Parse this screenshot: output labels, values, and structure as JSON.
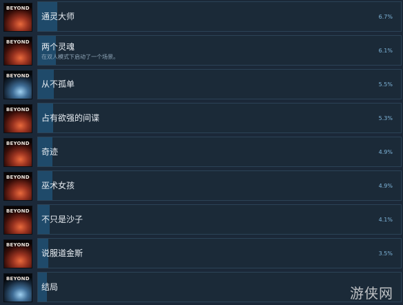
{
  "thumbnail_logo": "BEYOND",
  "achievements": [
    {
      "name": "通灵大师",
      "description": "",
      "percent_label": "6.7%",
      "percent": 6.7,
      "thumb_tone": "warm"
    },
    {
      "name": "两个灵魂",
      "description": "在双人模式下启动了一个场景。",
      "percent_label": "6.1%",
      "percent": 6.1,
      "thumb_tone": "warm"
    },
    {
      "name": "从不孤单",
      "description": "",
      "percent_label": "5.5%",
      "percent": 5.5,
      "thumb_tone": "cool"
    },
    {
      "name": "占有欲强的间谍",
      "description": "",
      "percent_label": "5.3%",
      "percent": 5.3,
      "thumb_tone": "warm"
    },
    {
      "name": "奇迹",
      "description": "",
      "percent_label": "4.9%",
      "percent": 4.9,
      "thumb_tone": "warm"
    },
    {
      "name": "巫术女孩",
      "description": "",
      "percent_label": "4.9%",
      "percent": 4.9,
      "thumb_tone": "warm"
    },
    {
      "name": "不只是沙子",
      "description": "",
      "percent_label": "4.1%",
      "percent": 4.1,
      "thumb_tone": "warm"
    },
    {
      "name": "说服道金斯",
      "description": "",
      "percent_label": "3.5%",
      "percent": 3.5,
      "thumb_tone": "warm"
    },
    {
      "name": "结局",
      "description": "",
      "percent_label": "",
      "percent": 3.2,
      "thumb_tone": "cool"
    }
  ],
  "watermark": "游侠网",
  "colors": {
    "background": "#1b2838",
    "bar_fill": "#1f4a6a",
    "percent_text": "#7fb5da"
  }
}
